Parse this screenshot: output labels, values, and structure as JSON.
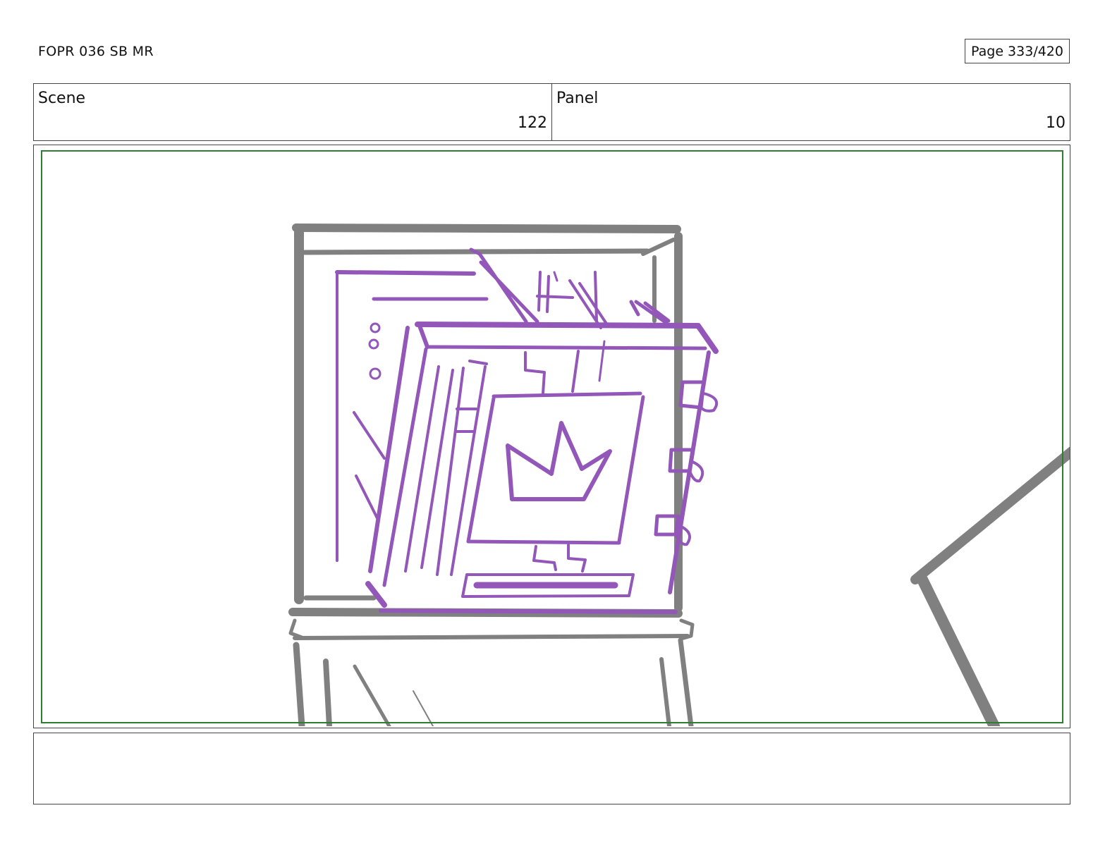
{
  "header": {
    "doc_title": "FOPR 036 SB MR",
    "page_label": "Page 333/420"
  },
  "info": {
    "scene_label": "Scene",
    "scene_value": "122",
    "panel_label": "Panel",
    "panel_value": "10"
  },
  "colors": {
    "frame_safe": "#2e7d32",
    "sketch_gray": "#808080",
    "sketch_purple": "#9257b8"
  },
  "notes": {
    "text": ""
  }
}
